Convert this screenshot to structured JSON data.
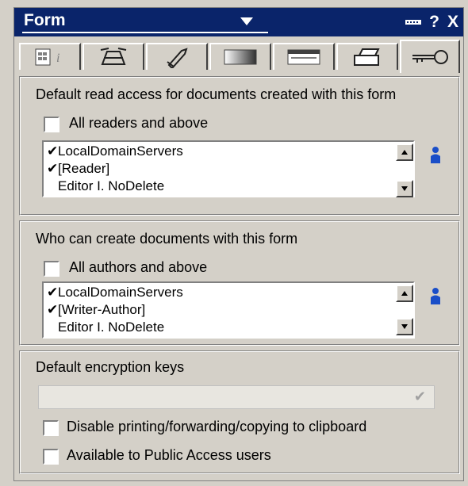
{
  "window": {
    "title": "Form",
    "help_label": "?",
    "close_label": "X"
  },
  "tabs": [
    {
      "name": "info-tab"
    },
    {
      "name": "defaults-tab"
    },
    {
      "name": "launch-tab"
    },
    {
      "name": "background-tab"
    },
    {
      "name": "header-tab"
    },
    {
      "name": "print-tab"
    },
    {
      "name": "security-tab",
      "active": true
    }
  ],
  "read_access": {
    "heading": "Default read access for documents created with this form",
    "all_label": "All readers and above",
    "items": [
      {
        "checked": true,
        "label": "LocalDomainServers"
      },
      {
        "checked": true,
        "label": "[Reader]"
      },
      {
        "checked": false,
        "label": "Editor I. NoDelete"
      }
    ]
  },
  "create_access": {
    "heading": "Who can create documents with this form",
    "all_label": "All authors and above",
    "items": [
      {
        "checked": true,
        "label": "LocalDomainServers"
      },
      {
        "checked": true,
        "label": "[Writer-Author]"
      },
      {
        "checked": false,
        "label": "Editor I. NoDelete"
      }
    ]
  },
  "encryption": {
    "heading": "Default encryption keys",
    "value": "",
    "disable_printing_label": "Disable printing/forwarding/copying to clipboard",
    "public_access_label": "Available to Public Access users"
  },
  "colors": {
    "titlebar": "#0a246a",
    "face": "#d4d0c8",
    "person_icon": "#1a4ec8"
  }
}
